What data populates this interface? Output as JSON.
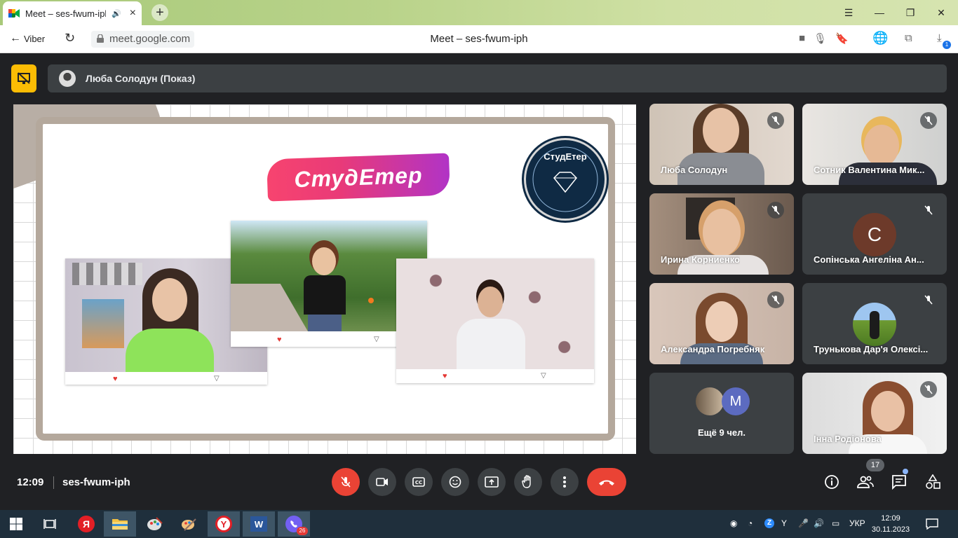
{
  "browser": {
    "tab_title": "Meet – ses-fwum-iph",
    "back_label": "Viber",
    "url": "meet.google.com",
    "page_title": "Meet – ses-fwum-iph",
    "download_badge": "1"
  },
  "presenter": {
    "label": "Люба Солодун (Показ)"
  },
  "slide": {
    "logo_text": "СтудЕтер",
    "seal_text": "СтудЕтер"
  },
  "participants": [
    {
      "name": "Люба Солодун",
      "muted": true
    },
    {
      "name": "Сотник Валентина Мик...",
      "muted": true
    },
    {
      "name": "Ирина Корниенко",
      "muted": true
    },
    {
      "name": "Сопінська Ангеліна Ан...",
      "muted": true,
      "avatar_letter": "С"
    },
    {
      "name": "Александра Погребняк",
      "muted": true
    },
    {
      "name": "Трунькова Дар'я Олексі...",
      "muted": true
    },
    {
      "name": "Ещё 9 чел.",
      "avatar_letter": "M"
    },
    {
      "name": "Інна Родіонова",
      "muted": true
    }
  ],
  "meeting": {
    "time": "12:09",
    "code": "ses-fwum-iph",
    "people_count": "17"
  },
  "taskbar": {
    "viber_badge": "26",
    "language": "УКР",
    "clock_time": "12:09",
    "clock_date": "30.11.2023"
  },
  "colors": {
    "meet_bg": "#202124",
    "tile_bg": "#3c4043",
    "end_call": "#ea4335",
    "present_accent": "#fbbc04"
  }
}
